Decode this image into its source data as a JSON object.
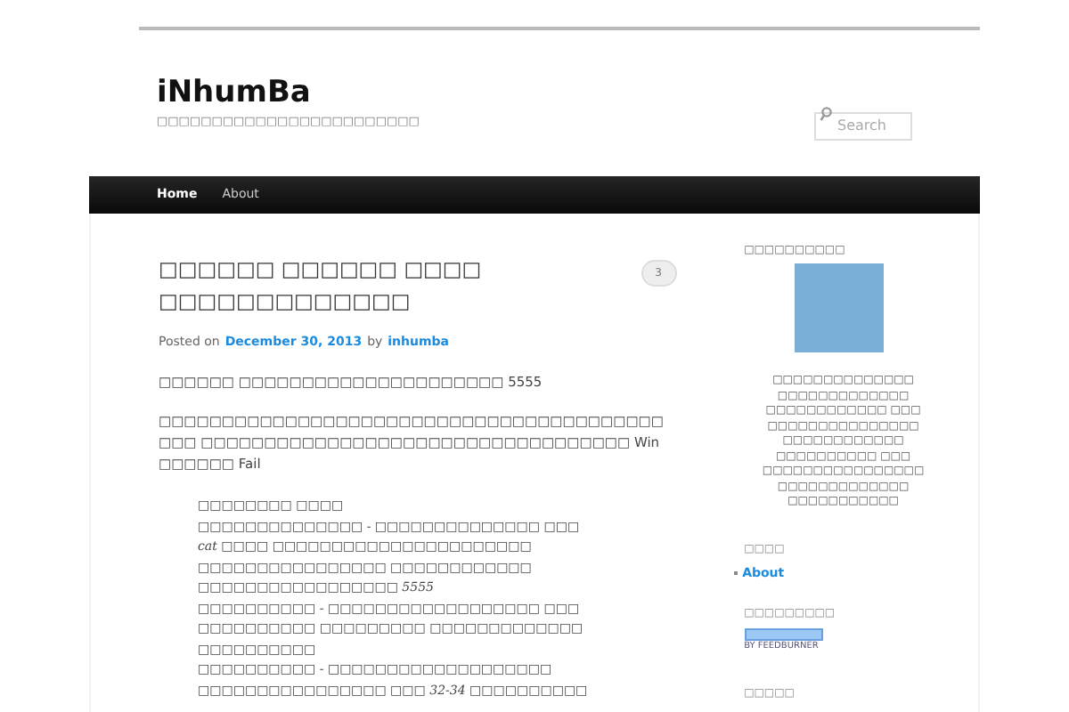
{
  "site": {
    "title": "iNhumBa",
    "tagline": "□□□□□□□□□□□□□□□□□□□□□□□□"
  },
  "search": {
    "placeholder": "Search"
  },
  "nav": [
    {
      "label": "Home",
      "selected": true
    },
    {
      "label": "About",
      "selected": false
    }
  ],
  "post": {
    "title": "□□□□□□ □□□□□□ □□□□ □□□□□□□□□□□□□",
    "comments": "3",
    "posted_on": "Posted on",
    "date": "December 30, 2013",
    "by": "by",
    "author": "inhumba",
    "paragraphs": [
      "□□□□□□ □□□□□□□□□□□□□□□□□□□□□ 5555",
      "□□□□□□□□□□□□□□□□□□□□□□□□□□□□□□□□□□□□□□□□□□□ □□□□□□□□□□□□□□□□□□□□□□□□□□□□□□□□□□ Win □□□□□□ Fail"
    ],
    "quote_lines": [
      "□□□□□□□□ □□□□",
      "□□□□□□□□□□□□□□ - □□□□□□□□□□□□□□ □□□",
      "*cat* □□□□ □□□□□□□□□□□□□□□□□□□□□□",
      "□□□□□□□□□□□□□□□□ □□□□□□□□□□□□",
      "□□□□□□□□□□□□□□□□□ *5555*",
      "□□□□□□□□□□ - □□□□□□□□□□□□□□□□□□ □□□",
      "□□□□□□□□□□ □□□□□□□□□ □□□□□□□□□□□□□",
      "□□□□□□□□□□",
      "□□□□□□□□□□ - □□□□□□□□□□□□□□□□□□□",
      "□□□□□□□□□□□□□□□□ □□□ *32-34* □□□□□□□□□□"
    ]
  },
  "sidebar": {
    "profile_heading": "□□□□□□□□□□",
    "profile_lines": [
      "□□□□□□□□□□□□□□",
      "□□□□□□□□□□□□□",
      "□□□□□□□□□□□□ □□□",
      "□□□□□□□□□□□□□□□",
      "□□□□□□□□□□□□",
      "□□□□□□□□□□ □□□",
      "□□□□□□□□□□□□□□□□",
      "□□□□□□□□□□□□□",
      "□□□□□□□□□□□"
    ],
    "pages_heading": "□□□□",
    "pages": [
      "About"
    ],
    "feed_heading": "□□□□□□□□□",
    "feed_badge": "BY FEEDBURNER",
    "last_heading": "□□□□□"
  }
}
